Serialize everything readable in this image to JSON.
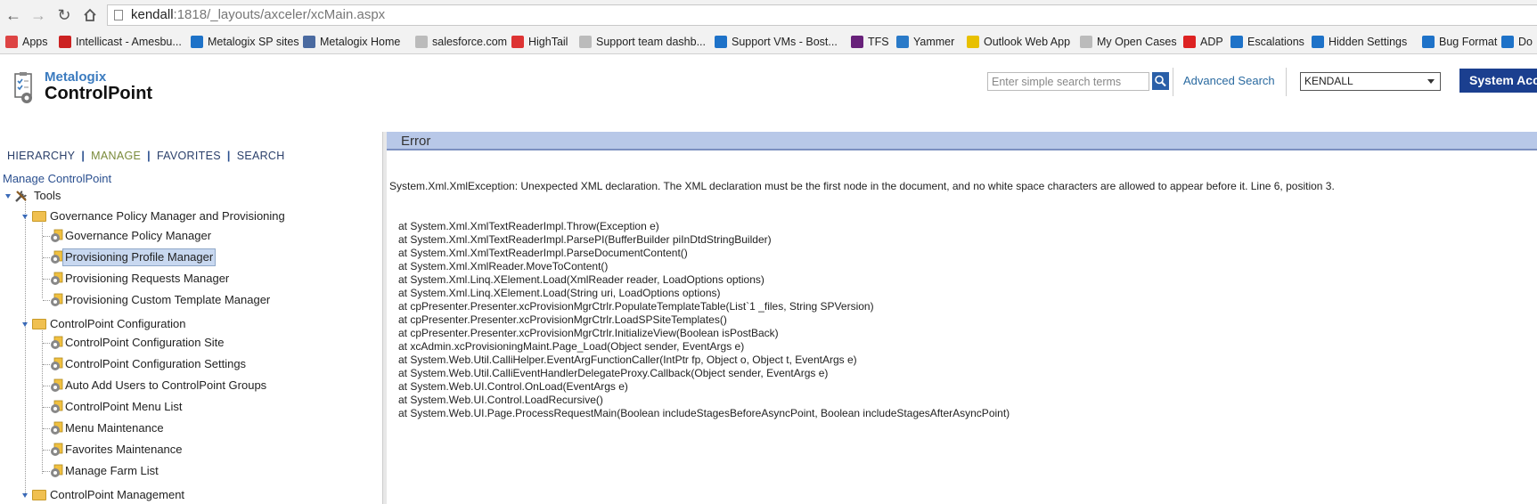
{
  "browser": {
    "url_host": "kendall",
    "url_path": ":1818/_layouts/axceler/xcMain.aspx",
    "bookmarks": [
      {
        "label": "Apps",
        "icon": "apps-grid-icon",
        "color": "#d44"
      },
      {
        "label": "Intellicast - Amesbu...",
        "icon": "intellicast-icon",
        "color": "#c22"
      },
      {
        "label": "Metalogix SP sites",
        "icon": "sharepoint-icon",
        "color": "#1e72c8"
      },
      {
        "label": "Metalogix Home",
        "icon": "metalogix-icon",
        "color": "#4a6aa0"
      },
      {
        "label": "salesforce.com",
        "icon": "cloud-icon",
        "color": "#bbb"
      },
      {
        "label": "HighTail",
        "icon": "hightail-icon",
        "color": "#d33"
      },
      {
        "label": "Support team dashb...",
        "icon": "cloud-icon",
        "color": "#bbb"
      },
      {
        "label": "Support VMs - Bost...",
        "icon": "sharepoint-icon",
        "color": "#1e72c8"
      },
      {
        "label": "TFS",
        "icon": "visual-studio-icon",
        "color": "#68217a"
      },
      {
        "label": "Yammer",
        "icon": "yammer-icon",
        "color": "#2a7ac8"
      },
      {
        "label": "Outlook Web App",
        "icon": "outlook-icon",
        "color": "#e8c000"
      },
      {
        "label": "My Open Cases",
        "icon": "cloud-icon",
        "color": "#bbb"
      },
      {
        "label": "ADP",
        "icon": "adp-icon",
        "color": "#d22"
      },
      {
        "label": "Escalations",
        "icon": "sharepoint-icon",
        "color": "#1e72c8"
      },
      {
        "label": "Hidden Settings",
        "icon": "sharepoint-icon",
        "color": "#1e72c8"
      },
      {
        "label": "Bug Format",
        "icon": "sharepoint-icon",
        "color": "#1e72c8"
      },
      {
        "label": "Do",
        "icon": "sharepoint-icon",
        "color": "#1e72c8"
      }
    ]
  },
  "header": {
    "logo_brand": "Metalogix",
    "logo_product": "ControlPoint",
    "search_placeholder": "Enter simple search terms",
    "advanced_search": "Advanced Search",
    "farm_selected": "KENDALL",
    "system_account": "System Acc"
  },
  "nav": {
    "hierarchy": "HIERARCHY",
    "manage": "MANAGE",
    "favorites": "FAVORITES",
    "search": "SEARCH",
    "separator": "|",
    "manage_title": "Manage ControlPoint"
  },
  "tree": {
    "tools": "Tools",
    "gpm_folder": "Governance Policy Manager and Provisioning",
    "gpm": "Governance Policy Manager",
    "ppm": "Provisioning Profile Manager",
    "prm": "Provisioning Requests Manager",
    "pctm": "Provisioning Custom Template Manager",
    "cpc_folder": "ControlPoint Configuration",
    "cpc_site": "ControlPoint Configuration Site",
    "cpc_settings": "ControlPoint Configuration Settings",
    "auto_add": "Auto Add Users to ControlPoint Groups",
    "menu_list": "ControlPoint Menu List",
    "menu_maint": "Menu Maintenance",
    "fav_maint": "Favorites Maintenance",
    "farm_list": "Manage Farm List",
    "cpm_folder": "ControlPoint Management"
  },
  "error": {
    "title": "Error",
    "message": "System.Xml.XmlException: Unexpected XML declaration. The XML declaration must be the first node in the document, and no white space characters are allowed to appear before it. Line 6, position 3.",
    "stack": [
      "at System.Xml.XmlTextReaderImpl.Throw(Exception e)",
      "at System.Xml.XmlTextReaderImpl.ParsePI(BufferBuilder piInDtdStringBuilder)",
      "at System.Xml.XmlTextReaderImpl.ParseDocumentContent()",
      "at System.Xml.XmlReader.MoveToContent()",
      "at System.Xml.Linq.XElement.Load(XmlReader reader, LoadOptions options)",
      "at System.Xml.Linq.XElement.Load(String uri, LoadOptions options)",
      "at cpPresenter.Presenter.xcProvisionMgrCtrlr.PopulateTemplateTable(List`1 _files, String SPVersion)",
      "at cpPresenter.Presenter.xcProvisionMgrCtrlr.LoadSPSiteTemplates()",
      "at cpPresenter.Presenter.xcProvisionMgrCtrlr.InitializeView(Boolean isPostBack)",
      "at xcAdmin.xcProvisioningMaint.Page_Load(Object sender, EventArgs e)",
      "at System.Web.Util.CalliHelper.EventArgFunctionCaller(IntPtr fp, Object o, Object t, EventArgs e)",
      "at System.Web.Util.CalliEventHandlerDelegateProxy.Callback(Object sender, EventArgs e)",
      "at System.Web.UI.Control.OnLoad(EventArgs e)",
      "at System.Web.UI.Control.LoadRecursive()",
      "at System.Web.UI.Page.ProcessRequestMain(Boolean includeStagesBeforeAsyncPoint, Boolean includeStagesAfterAsyncPoint)"
    ]
  }
}
